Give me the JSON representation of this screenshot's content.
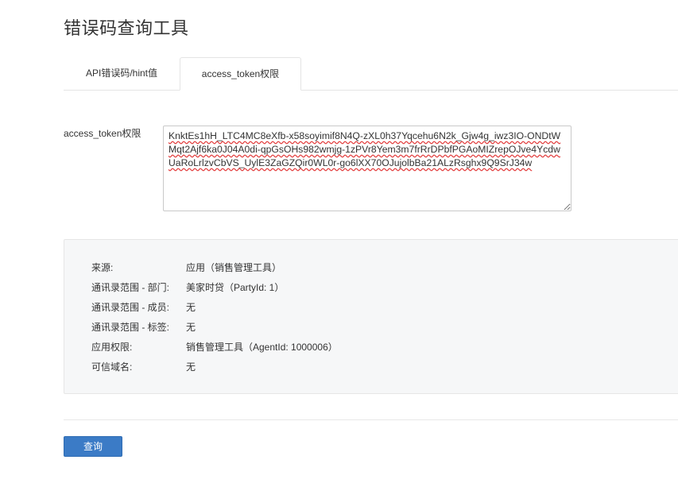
{
  "page": {
    "title": "错误码查询工具"
  },
  "tabs": [
    {
      "label": "API错误码/hint值",
      "active": false
    },
    {
      "label": "access_token权限",
      "active": true
    }
  ],
  "form": {
    "token_label": "access_token权限",
    "token_value": "KnktEs1hH_LTC4MC8eXfb-x58soyimif8N4Q-zXL0h37Yqcehu6N2k_Gjw4g_iwz3IO-ONDtWMqt2Ajf6ka0J04A0di-qpGsOHs982wmjg-1zPVr8Yem3m7frRrDPbfPGAoMIZrepOJve4YcdwUaRoLrlzvCbVS_UylE3ZaGZQir0WL0r-go6lXX70OJujolbBa21ALzRsghx9Q9SrJ34w"
  },
  "info": {
    "rows": [
      {
        "key": "来源:",
        "value": "应用（销售管理工具）"
      },
      {
        "key": "通讯录范围 - 部门:",
        "value": "美家时贷（PartyId: 1）"
      },
      {
        "key": "通讯录范围 - 成员:",
        "value": "无"
      },
      {
        "key": "通讯录范围 - 标签:",
        "value": "无"
      },
      {
        "key": "应用权限:",
        "value": "销售管理工具（AgentId: 1000006）"
      },
      {
        "key": "可信域名:",
        "value": "无"
      }
    ]
  },
  "actions": {
    "query_label": "查询"
  }
}
